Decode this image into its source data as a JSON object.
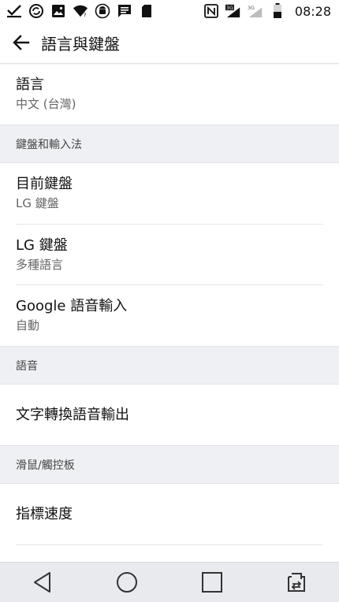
{
  "status_bar": {
    "left_icons": [
      "check-icon",
      "sync-icon",
      "image-icon",
      "wifi-icon",
      "android-icon",
      "message-icon",
      "sd-card-icon"
    ],
    "right_icons": [
      "nfc-icon",
      "signal-3g-icon",
      "signal-3g-icon",
      "battery-icon"
    ],
    "network_labels": [
      "3G",
      "3G"
    ],
    "time": "08:28"
  },
  "app_bar": {
    "title": "語言與鍵盤"
  },
  "settings": {
    "language": {
      "title": "語言",
      "summary": "中文 (台灣)"
    },
    "keyboard_section": {
      "header": "鍵盤和輸入法"
    },
    "current_keyboard": {
      "title": "目前鍵盤",
      "summary": "LG 鍵盤"
    },
    "lg_keyboard": {
      "title": "LG 鍵盤",
      "summary": "多種語言"
    },
    "google_voice": {
      "title": "Google 語音輸入",
      "summary": "自動"
    },
    "speech_section": {
      "header": "語音"
    },
    "tts_output": {
      "title": "文字轉換語音輸出"
    },
    "mouse_section": {
      "header": "滑鼠/觸控板"
    },
    "pointer_speed": {
      "title": "指標速度"
    }
  },
  "nav_bar": {
    "buttons": [
      "back-icon",
      "home-icon",
      "recents-icon",
      "dual-window-icon"
    ]
  },
  "colors": {
    "header_bg": "#eff0f3",
    "navbar_bg": "#e9eaed",
    "text_primary": "#111111",
    "text_secondary": "#666666"
  }
}
